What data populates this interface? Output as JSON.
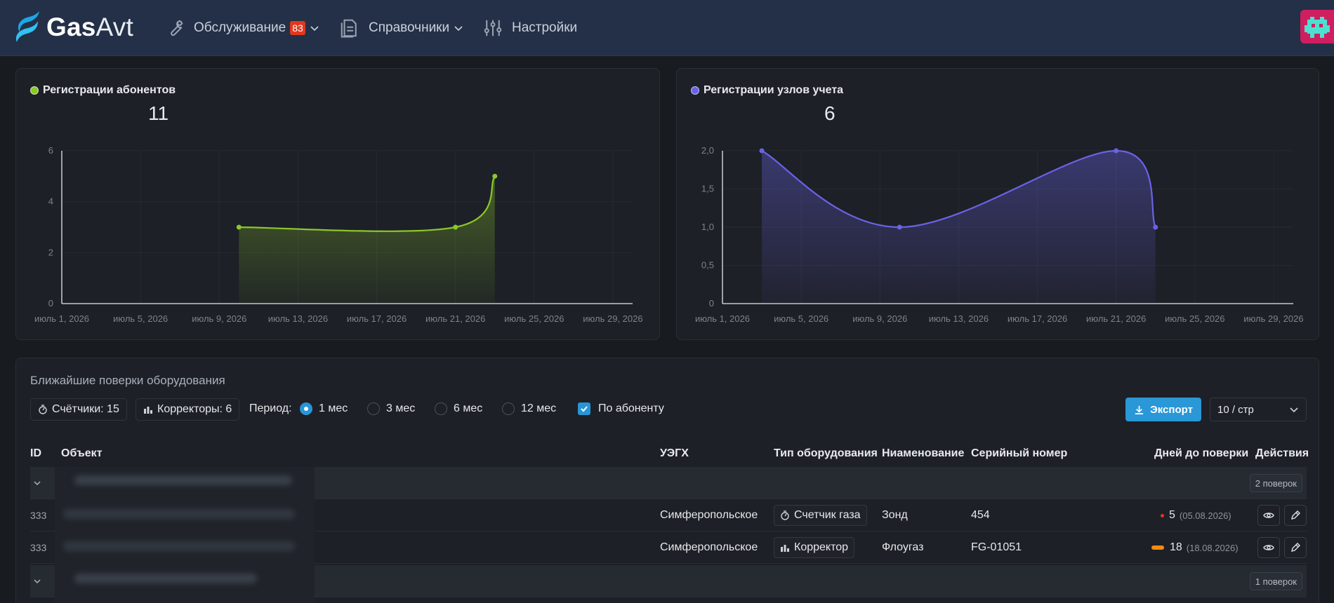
{
  "app": {
    "logo_bold": "Gas",
    "logo_light": "Avt"
  },
  "nav": {
    "items": [
      {
        "label": "Обслуживание",
        "badge": "83",
        "icon": "wrench-icon"
      },
      {
        "label": "Справочники",
        "icon": "documents-icon"
      },
      {
        "label": "Настройки",
        "icon": "sliders-icon"
      }
    ]
  },
  "colors": {
    "nav_bg": "#243047",
    "green": "#8bc72a",
    "purple": "#6a62e6",
    "accent": "#2a97d7",
    "badge": "#e2371f"
  },
  "charts": [
    {
      "title": "Регистрации абонентов",
      "total": "11",
      "color": "#8bc72a"
    },
    {
      "title": "Регистрации узлов учета",
      "total": "6",
      "color": "#6a62e6"
    }
  ],
  "chart_data": [
    {
      "type": "area",
      "title": "Регистрации абонентов",
      "x_ticks": [
        "июль 1, 2026",
        "июль 5, 2026",
        "июль 9, 2026",
        "июль 13, 2026",
        "июль 17, 2026",
        "июль 21, 2026",
        "июль 25, 2026",
        "июль 29, 2026"
      ],
      "y_ticks": [
        "0",
        "2",
        "4",
        "6"
      ],
      "ylim": [
        0,
        6
      ],
      "xlim": [
        "2026-07-01",
        "2026-07-30"
      ],
      "points": [
        {
          "x": "2026-07-10",
          "y": 3
        },
        {
          "x": "2026-07-21",
          "y": 3
        },
        {
          "x": "2026-07-23",
          "y": 5
        }
      ],
      "grid": true
    },
    {
      "type": "area",
      "title": "Регистрации узлов учета",
      "x_ticks": [
        "июль 1, 2026",
        "июль 5, 2026",
        "июль 9, 2026",
        "июль 13, 2026",
        "июль 17, 2026",
        "июль 21, 2026",
        "июль 25, 2026",
        "июль 29, 2026"
      ],
      "y_ticks": [
        "0",
        "0,5",
        "1,0",
        "1,5",
        "2,0"
      ],
      "ylim": [
        0,
        2
      ],
      "xlim": [
        "2026-07-01",
        "2026-07-30"
      ],
      "points": [
        {
          "x": "2026-07-03",
          "y": 2
        },
        {
          "x": "2026-07-10",
          "y": 1
        },
        {
          "x": "2026-07-21",
          "y": 2
        },
        {
          "x": "2026-07-23",
          "y": 1
        }
      ],
      "grid": true
    }
  ],
  "table_section": {
    "title": "Ближайшие поверки оборудования",
    "chip_meters": "Счётчики: 15",
    "chip_correctors": "Корректоры: 6",
    "period_label": "Период:",
    "periods": [
      "1 мес",
      "3 мес",
      "6 мес",
      "12 мес"
    ],
    "selected_period": "1 мес",
    "by_subscriber_label": "По абоненту",
    "by_subscriber_checked": true,
    "export_label": "Экспорт",
    "page_size": "10 / стр"
  },
  "table": {
    "columns": [
      "ID",
      "Объект",
      "УЭГХ",
      "Тип оборудования",
      "Ниаменование",
      "Серийный номер",
      "Дней до поверки",
      "Действия"
    ],
    "groups": [
      {
        "tag": "2 поверок",
        "rows": [
          {
            "id": "333",
            "uegh": "Симферопольское",
            "type": "Счетчик газа",
            "type_icon": "gas-meter-icon",
            "name": "Зонд",
            "serial": "454",
            "days": "5",
            "date": "(05.08.2026)",
            "status": "red"
          },
          {
            "id": "333",
            "uegh": "Симферопольское",
            "type": "Корректор",
            "type_icon": "bar-chart-icon",
            "name": "Флоугаз",
            "serial": "FG-01051",
            "days": "18",
            "date": "(18.08.2026)",
            "status": "orange"
          }
        ]
      },
      {
        "tag": "1 поверок",
        "rows": []
      }
    ]
  }
}
